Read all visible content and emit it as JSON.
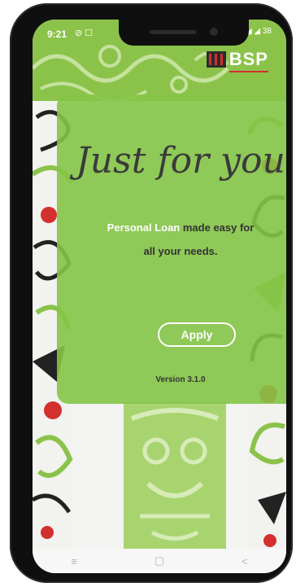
{
  "status_bar": {
    "time": "9:21",
    "left_icons": "⊘ ☐",
    "right_icons": "◢ ◢ 38"
  },
  "header": {
    "logo_text": "BSP"
  },
  "card": {
    "title": "Just for you",
    "highlight": "Personal Loan",
    "line1_rest": "made easy for",
    "line2": "all your needs.",
    "apply_label": "Apply",
    "version": "Version 3.1.0"
  },
  "navbar": {
    "menu_icon": "≡",
    "home_icon": "▢",
    "back_icon": "<"
  },
  "colors": {
    "brand_green": "#8bc34a",
    "card_green": "#84c446",
    "accent_red": "#d32f2f"
  }
}
